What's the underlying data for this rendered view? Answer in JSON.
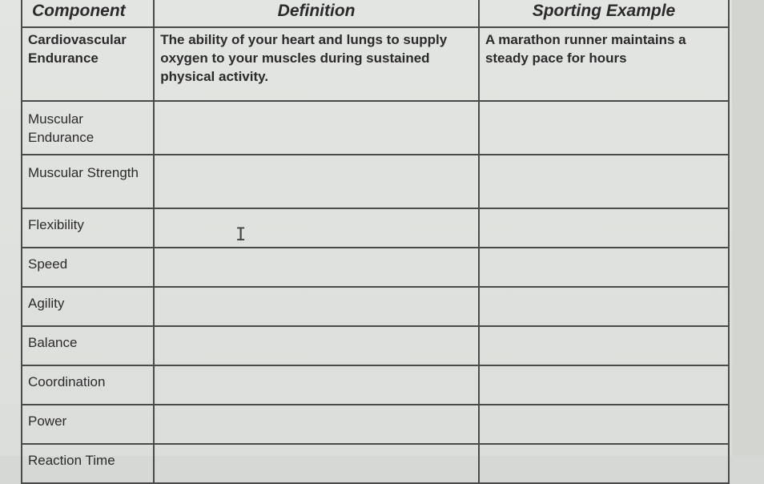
{
  "table": {
    "headers": [
      "Component",
      "Definition",
      "Sporting Example"
    ],
    "rows": [
      {
        "component": "Cardiovascular Endurance",
        "definition": "The ability of your heart and lungs to supply oxygen to your muscles during sustained physical activity.",
        "example": "A marathon runner maintains a steady pace for hours"
      },
      {
        "component": "Muscular Endurance",
        "definition": "",
        "example": ""
      },
      {
        "component": "Muscular Strength",
        "definition": "",
        "example": ""
      },
      {
        "component": "Flexibility",
        "definition": "",
        "example": ""
      },
      {
        "component": "Speed",
        "definition": "",
        "example": ""
      },
      {
        "component": "Agility",
        "definition": "",
        "example": ""
      },
      {
        "component": "Balance",
        "definition": "",
        "example": ""
      },
      {
        "component": "Coordination",
        "definition": "",
        "example": ""
      },
      {
        "component": "Power",
        "definition": "",
        "example": ""
      },
      {
        "component": "Reaction Time",
        "definition": "",
        "example": ""
      }
    ]
  },
  "cursor": {
    "icon": "text-cursor-icon",
    "glyph": "I"
  }
}
